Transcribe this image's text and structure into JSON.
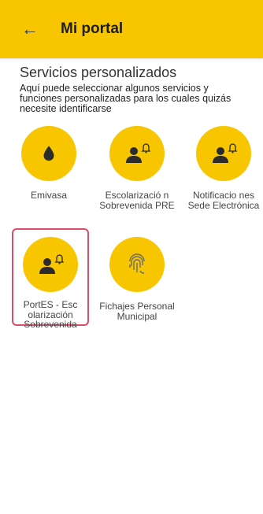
{
  "header": {
    "back_icon": "arrow-left-icon",
    "title": "Mi portal"
  },
  "section": {
    "title": "Servicios personalizados",
    "description": "Aquí puede seleccionar algunos servicios y funciones personalizadas para los cuales quizás necesite identificarse"
  },
  "services": [
    {
      "label": "Emivasa",
      "icon": "water-drop-icon"
    },
    {
      "label": "Escolarizació n Sobrevenida PRE",
      "icon": "user-bell-icon"
    },
    {
      "label": "Notificacio nes Sede Electrónica",
      "icon": "user-bell-icon"
    },
    {
      "label": "PortES - Esc olarización Sobrevenida",
      "icon": "user-bell-icon",
      "selected": true
    },
    {
      "label": "Fichajes Personal Municipal",
      "icon": "fingerprint-icon"
    }
  ],
  "colors": {
    "accent": "#f7c600",
    "selection_border": "#d94f6a"
  }
}
